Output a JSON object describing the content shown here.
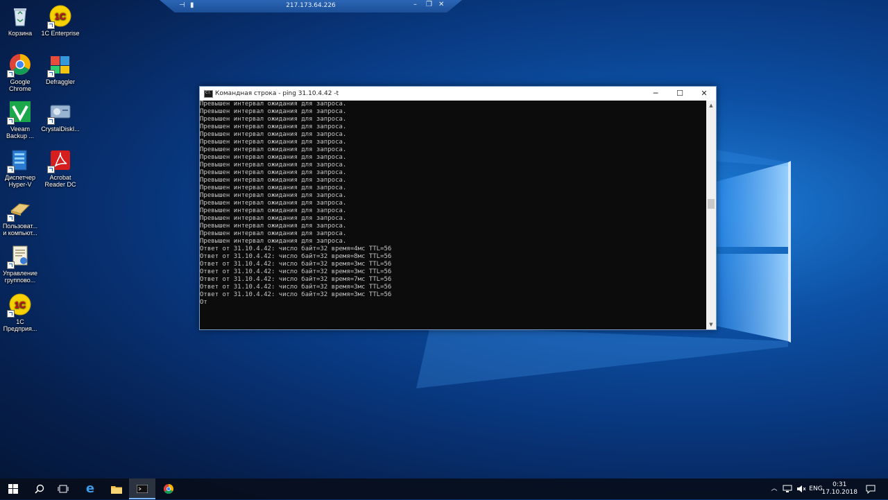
{
  "remote_bar": {
    "host": "217.173.64.226"
  },
  "desktop_icons": [
    {
      "label": "Корзина",
      "icon": "recycle-bin-icon"
    },
    {
      "label": "1C Enterprise",
      "icon": "1c-icon"
    },
    {
      "label": "Google\nChrome",
      "icon": "chrome-icon"
    },
    {
      "label": "Defraggler",
      "icon": "defraggler-icon"
    },
    {
      "label": "Veeam\nBackup ...",
      "icon": "veeam-icon"
    },
    {
      "label": "CrystalDiskI...",
      "icon": "crystaldisk-icon"
    },
    {
      "label": "Диспетчер\nHyper-V",
      "icon": "hyperv-icon"
    },
    {
      "label": "Acrobat\nReader DC",
      "icon": "acrobat-icon"
    },
    {
      "label": "Пользоват...\nи компьют...",
      "icon": "users-computers-icon"
    },
    {
      "label": "Управление\nгруппово...",
      "icon": "group-policy-icon"
    },
    {
      "label": "1C\nПредприя...",
      "icon": "1c-icon"
    }
  ],
  "window": {
    "title": "Командная строка - ping  31.10.4.42 -t",
    "lines": [
      "Превышен интервал ожидания для запроса.",
      "Превышен интервал ожидания для запроса.",
      "Превышен интервал ожидания для запроса.",
      "Превышен интервал ожидания для запроса.",
      "Превышен интервал ожидания для запроса.",
      "Превышен интервал ожидания для запроса.",
      "Превышен интервал ожидания для запроса.",
      "Превышен интервал ожидания для запроса.",
      "Превышен интервал ожидания для запроса.",
      "Превышен интервал ожидания для запроса.",
      "Превышен интервал ожидания для запроса.",
      "Превышен интервал ожидания для запроса.",
      "Превышен интервал ожидания для запроса.",
      "Превышен интервал ожидания для запроса.",
      "Превышен интервал ожидания для запроса.",
      "Превышен интервал ожидания для запроса.",
      "Превышен интервал ожидания для запроса.",
      "Превышен интервал ожидания для запроса.",
      "Превышен интервал ожидания для запроса.",
      "Ответ от 31.10.4.42: число байт=32 время=4мс TTL=56",
      "Ответ от 31.10.4.42: число байт=32 время=8мс TTL=56",
      "Ответ от 31.10.4.42: число байт=32 время=3мс TTL=56",
      "Ответ от 31.10.4.42: число байт=32 время=3мс TTL=56",
      "Ответ от 31.10.4.42: число байт=32 время=7мс TTL=56",
      "Ответ от 31.10.4.42: число байт=32 время=3мс TTL=56",
      "Ответ от 31.10.4.42: число байт=32 время=3мс TTL=56",
      "От"
    ]
  },
  "taskbar": {
    "apps": [
      "start-icon",
      "search-icon",
      "task-view-icon",
      "edge-icon",
      "file-explorer-icon",
      "cmd-icon",
      "chrome-icon"
    ],
    "language": "ENG",
    "time": "0:31",
    "date": "17.10.2018"
  }
}
